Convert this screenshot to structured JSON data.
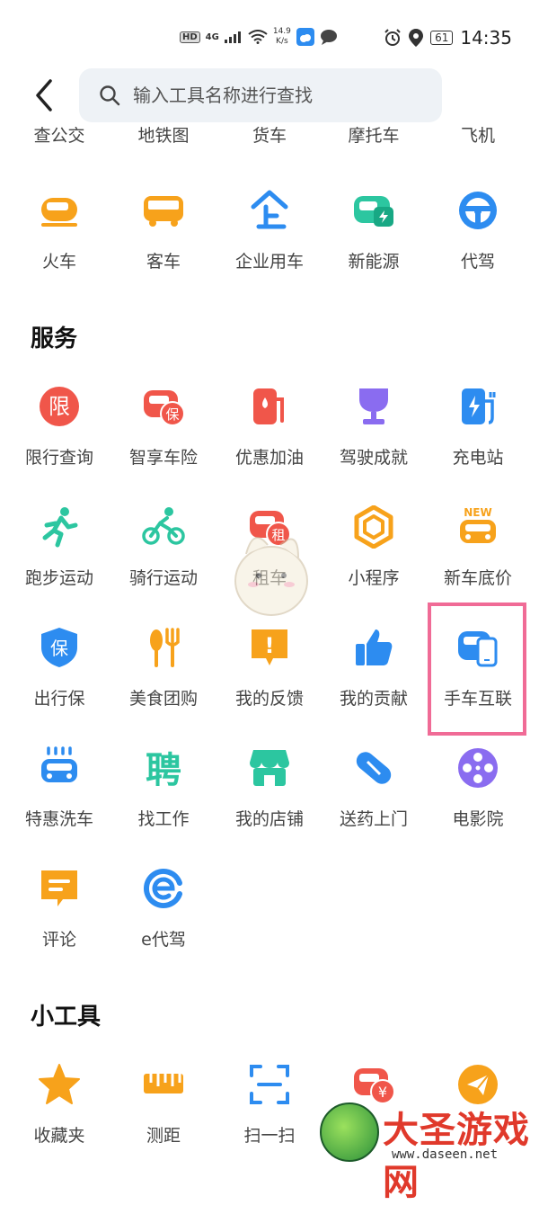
{
  "status_bar": {
    "hd": "HD",
    "network": "4G",
    "speed_value": "14.9",
    "speed_unit": "K/s",
    "battery": "61",
    "time": "14:35"
  },
  "search": {
    "placeholder": "输入工具名称进行查找"
  },
  "cut_row": [
    "查公交",
    "地铁图",
    "货车",
    "摩托车",
    "飞机"
  ],
  "transport_row": [
    {
      "label": "火车",
      "icon": "train-icon"
    },
    {
      "label": "客车",
      "icon": "bus-icon"
    },
    {
      "label": "企业用车",
      "icon": "enterprise-car-icon"
    },
    {
      "label": "新能源",
      "icon": "ev-car-icon"
    },
    {
      "label": "代驾",
      "icon": "steering-wheel-icon"
    }
  ],
  "services": {
    "title": "服务",
    "rows": [
      [
        {
          "label": "限行查询",
          "badge": "限",
          "icon": "restriction-icon"
        },
        {
          "label": "智享车险",
          "badge": "保",
          "icon": "car-insurance-icon"
        },
        {
          "label": "优惠加油",
          "icon": "fuel-pump-icon"
        },
        {
          "label": "驾驶成就",
          "icon": "trophy-icon"
        },
        {
          "label": "充电站",
          "icon": "charging-station-icon"
        }
      ],
      [
        {
          "label": "跑步运动",
          "icon": "running-icon"
        },
        {
          "label": "骑行运动",
          "icon": "cycling-icon"
        },
        {
          "label": "租车",
          "badge": "租",
          "icon": "car-rental-icon"
        },
        {
          "label": "小程序",
          "icon": "mini-program-icon"
        },
        {
          "label": "新车底价",
          "badge": "NEW",
          "icon": "new-car-price-icon"
        }
      ],
      [
        {
          "label": "出行保",
          "badge": "保",
          "icon": "shield-icon"
        },
        {
          "label": "美食团购",
          "icon": "food-icon"
        },
        {
          "label": "我的反馈",
          "badge": "!",
          "icon": "feedback-icon"
        },
        {
          "label": "我的贡献",
          "icon": "thumbs-up-icon"
        },
        {
          "label": "手车互联",
          "icon": "phone-car-link-icon"
        }
      ],
      [
        {
          "label": "特惠洗车",
          "icon": "car-wash-icon"
        },
        {
          "label": "找工作",
          "badge": "聘",
          "icon": "job-icon"
        },
        {
          "label": "我的店铺",
          "icon": "shop-icon"
        },
        {
          "label": "送药上门",
          "icon": "pill-icon"
        },
        {
          "label": "电影院",
          "icon": "film-reel-icon"
        }
      ],
      [
        {
          "label": "评论",
          "icon": "comment-icon"
        },
        {
          "label": "e代驾",
          "icon": "e-driver-icon"
        }
      ]
    ]
  },
  "tools": {
    "title": "小工具",
    "items": [
      {
        "label": "收藏夹",
        "icon": "star-icon"
      },
      {
        "label": "测距",
        "icon": "ruler-icon"
      },
      {
        "label": "扫一扫",
        "icon": "scan-icon"
      },
      {
        "label": "",
        "badge": "¥",
        "icon": "car-yuan-icon"
      },
      {
        "label": "",
        "icon": "paper-plane-icon"
      }
    ]
  },
  "watermark": {
    "title": "大圣游戏网",
    "url": "www.daseen.net"
  },
  "colors": {
    "orange": "#f7a21b",
    "blue": "#2d8cf0",
    "red": "#f0564a",
    "teal": "#2cc6a0",
    "purple": "#8a6cf0",
    "highlight": "#f06b96"
  }
}
